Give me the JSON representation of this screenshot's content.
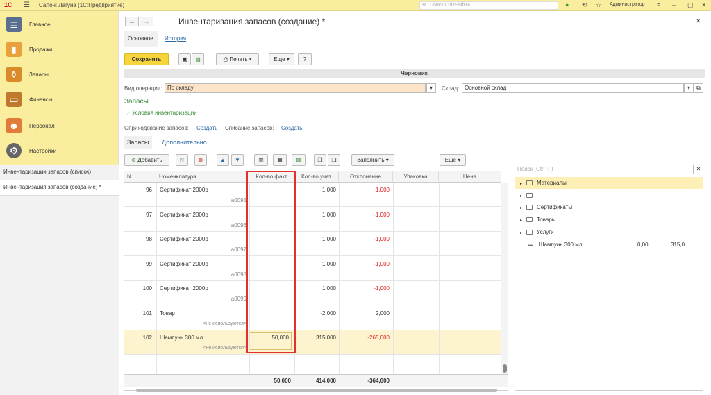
{
  "app": {
    "logo": "1С",
    "title": "Салон: Лагуна  (1С:Предприятие)",
    "search_placeholder": "Поиск Ctrl+Shift+F",
    "user": "Администратор"
  },
  "sidebar": {
    "items": [
      {
        "label": "Главное",
        "icon": "list-icon"
      },
      {
        "label": "Продажи",
        "icon": "chart-icon"
      },
      {
        "label": "Запасы",
        "icon": "bottles-icon"
      },
      {
        "label": "Финансы",
        "icon": "wallet-icon"
      },
      {
        "label": "Персонал",
        "icon": "people-icon"
      },
      {
        "label": "Настройки",
        "icon": "gear-icon"
      }
    ],
    "windows": [
      "Инвентаризации запасов (список)",
      "Инвентаризация запасов (создание) *"
    ]
  },
  "doc": {
    "title": "Инвентаризация запасов (создание) *",
    "tabs": [
      "Основное",
      "История"
    ],
    "save": "Сохранить",
    "print": "Печать",
    "more": "Еще",
    "help": "?",
    "status": "Черновик",
    "op_label": "Вид операции:",
    "op_value": "По складу",
    "warehouse_label": "Склад:",
    "warehouse_value": "Основной склад",
    "section": "Запасы",
    "conditions": "Условия инвентаризации",
    "receipt_label": "Оприходование запасов:",
    "receipt_link": "Создать",
    "writeoff_label": "Списание запасов:",
    "writeoff_link": "Создать",
    "subtabs": [
      "Запасы",
      "Дополнительно"
    ],
    "add": "Добавить",
    "fill": "Заполнить",
    "more2": "Еще"
  },
  "table": {
    "columns": [
      "N",
      "Номенклатура",
      "Кол-во факт",
      "Кол-во учет",
      "Отклонение",
      "Упаковка",
      "Цена"
    ],
    "rows": [
      {
        "n": "96",
        "name": "Сертификат 2000р",
        "sub": "а0095",
        "fact": "",
        "acc": "1,000",
        "dev": "-1,000"
      },
      {
        "n": "97",
        "name": "Сертификат 2000р",
        "sub": "а0096",
        "fact": "",
        "acc": "1,000",
        "dev": "-1,000"
      },
      {
        "n": "98",
        "name": "Сертификат 2000р",
        "sub": "а0097",
        "fact": "",
        "acc": "1,000",
        "dev": "-1,000"
      },
      {
        "n": "99",
        "name": "Сертификат 2000р",
        "sub": "а0098",
        "fact": "",
        "acc": "1,000",
        "dev": "-1,000"
      },
      {
        "n": "100",
        "name": "Сертификат 2000р",
        "sub": "а0099",
        "fact": "",
        "acc": "1,000",
        "dev": "-1,000"
      },
      {
        "n": "101",
        "name": "Товар",
        "sub": "<не используются>",
        "fact": "",
        "acc": "-2,000",
        "dev": "2,000"
      },
      {
        "n": "102",
        "name": "Шампунь 300 мл",
        "sub": "<не используются>",
        "fact": "50,000",
        "acc": "315,000",
        "dev": "-265,000"
      }
    ],
    "totals": {
      "fact": "50,000",
      "acc": "414,000",
      "dev": "-364,000"
    }
  },
  "picker": {
    "search_placeholder": "Поиск (Ctrl+F)",
    "items": [
      "Материалы",
      "",
      "Сертификаты",
      "Товары",
      "Услуги"
    ],
    "product": {
      "name": "Шампунь 300 мл",
      "qty": "0,00",
      "price": "315,0"
    }
  }
}
